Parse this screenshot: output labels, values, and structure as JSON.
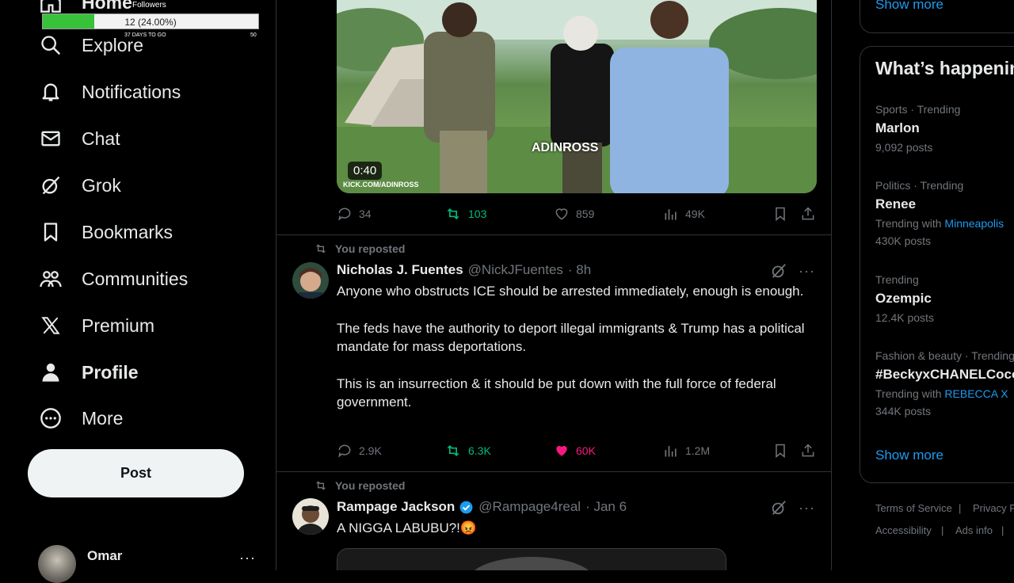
{
  "overlay": {
    "title": "Followers",
    "progress_text": "12 (24.00%)",
    "progress_fraction": 0.24,
    "days_text": "37 DAYS TO GO",
    "goal_text": "50"
  },
  "sidebar": {
    "items": [
      {
        "label": "Home",
        "icon": "home-icon"
      },
      {
        "label": "Explore",
        "icon": "search-icon"
      },
      {
        "label": "Notifications",
        "icon": "bell-icon"
      },
      {
        "label": "Chat",
        "icon": "mail-icon"
      },
      {
        "label": "Grok",
        "icon": "grok-icon"
      },
      {
        "label": "Bookmarks",
        "icon": "bookmark-icon"
      },
      {
        "label": "Communities",
        "icon": "people-icon"
      },
      {
        "label": "Premium",
        "icon": "x-logo-icon"
      },
      {
        "label": "Profile",
        "icon": "person-icon"
      },
      {
        "label": "More",
        "icon": "more-circle-icon"
      }
    ],
    "post_button": "Post",
    "account_name": "Omar",
    "account_menu": "···"
  },
  "feed": {
    "video_post": {
      "duration": "0:40",
      "watermark": "KICK.COM/ADINROSS",
      "tag": "ADINROSS",
      "stats": {
        "replies": "34",
        "reposts": "103",
        "likes": "859",
        "views": "49K"
      }
    },
    "tweet1": {
      "repost_label": "You reposted",
      "name": "Nicholas J. Fuentes",
      "handle": "@NickJFuentes",
      "time": "· 8h",
      "paragraphs": [
        "Anyone who obstructs ICE should be arrested immediately, enough is enough.",
        "The feds have the authority to deport illegal immigrants & Trump has a political mandate for mass deportations.",
        "This is an insurrection & it should be put down with the full force of federal government."
      ],
      "stats": {
        "replies": "2.9K",
        "reposts": "6.3K",
        "likes": "60K",
        "views": "1.2M"
      }
    },
    "tweet2": {
      "repost_label": "You reposted",
      "name": "Rampage Jackson",
      "handle": "@Rampage4real",
      "time": "· Jan 6",
      "text": "A NIGGA LABUBU?!😡"
    }
  },
  "right": {
    "show_more_top": "Show more",
    "trends_title": "What’s happening",
    "trends": [
      {
        "context": "Sports · Trending",
        "title": "Marlon",
        "with_prefix": "",
        "with_link": "",
        "count": "9,092 posts"
      },
      {
        "context": "Politics · Trending",
        "title": "Renee",
        "with_prefix": "Trending with",
        "with_link": "Minneapolis",
        "count": "430K posts"
      },
      {
        "context": "Trending",
        "title": "Ozempic",
        "with_prefix": "",
        "with_link": "",
        "count": "12.4K posts"
      },
      {
        "context": "Fashion & beauty · Trending",
        "title": "#BeckyxCHANELCoco",
        "with_prefix": "Trending with",
        "with_link": "REBECCA X",
        "count": "344K posts"
      }
    ],
    "show_more_bottom": "Show more",
    "footer": [
      "Terms of Service",
      "|",
      "Privacy Policy",
      "Accessibility",
      "|",
      "Ads info",
      "|"
    ]
  },
  "colors": {
    "accent": "#1d9bf0",
    "repost_green": "#00ba7c",
    "like_pink": "#f91880",
    "post_button_bg": "#eff3f4"
  }
}
